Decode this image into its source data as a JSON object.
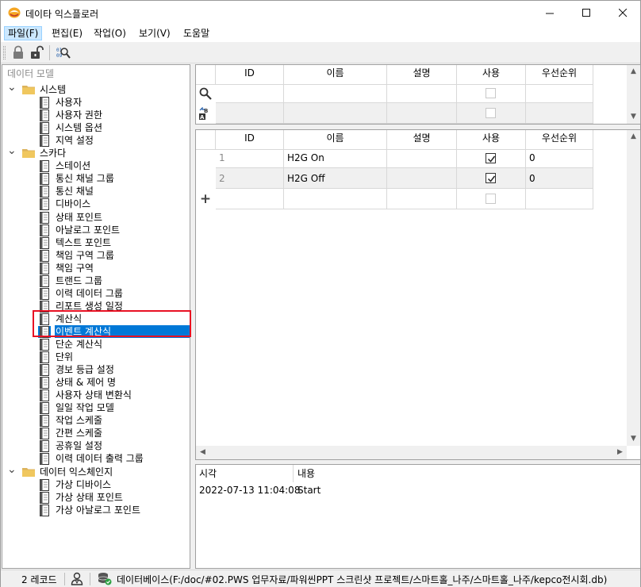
{
  "window": {
    "title": "데이타 익스플로러"
  },
  "menu": {
    "items": [
      "파일(F)",
      "편집(E)",
      "작업(O)",
      "보기(V)",
      "도움말"
    ]
  },
  "toolbar": {
    "icons": [
      "lock-icon",
      "unlock-icon",
      "binary-search-icon"
    ]
  },
  "tree": {
    "title": "데이터 모델",
    "groups": [
      {
        "label": "시스템",
        "items": [
          "사용자",
          "사용자 권한",
          "시스템 옵션",
          "지역 설정"
        ]
      },
      {
        "label": "스카다",
        "items": [
          "스테이션",
          "통신 채널 그룹",
          "통신 채널",
          "디바이스",
          "상태 포인트",
          "아날로그 포인트",
          "텍스트 포인트",
          "책임 구역 그룹",
          "책임 구역",
          "트랜드 그룹",
          "이력 데이터 그룹",
          "리포트 생성 일정",
          "계산식",
          "이벤트 계산식",
          "단순 계산식",
          "단위",
          "경보 등급 설정",
          "상태 & 제어 명",
          "사용자 상태 변환식",
          "일일 작업 모델",
          "작업 스케줄",
          "간편 스케줄",
          "공휴일 설정",
          "이력 데이터 출력 그룹"
        ]
      },
      {
        "label": "데이터 익스체인지",
        "items": [
          "가상 디바이스",
          "가상 상태 포인트",
          "가상 아날로그 포인트"
        ]
      }
    ],
    "selected": "이벤트 계산식"
  },
  "filter_grid": {
    "columns": [
      "ID",
      "이름",
      "설명",
      "사용",
      "우선순위"
    ]
  },
  "main_grid": {
    "columns": [
      "ID",
      "이름",
      "설명",
      "사용",
      "우선순위"
    ],
    "rows": [
      {
        "id": "1",
        "name": "H2G On",
        "desc": "",
        "use": true,
        "priority": "0"
      },
      {
        "id": "2",
        "name": "H2G Off",
        "desc": "",
        "use": true,
        "priority": "0"
      }
    ],
    "new_row_symbol": "+"
  },
  "log": {
    "columns": [
      "시각",
      "내용"
    ],
    "rows": [
      {
        "time": "2022-07-13 11:04:08",
        "message": "Start"
      }
    ]
  },
  "status": {
    "records": "2 레코드",
    "database": "데이터베이스(F:/doc/#02.PWS 업무자료/파워씬PPT 스크린샷 프로젝트/스마트홀_나주/스마트홀_나주/kepco전시회.db)"
  },
  "colors": {
    "selection": "#0078d7",
    "highlight_border": "#e81123",
    "folder": "#dcb35c"
  }
}
